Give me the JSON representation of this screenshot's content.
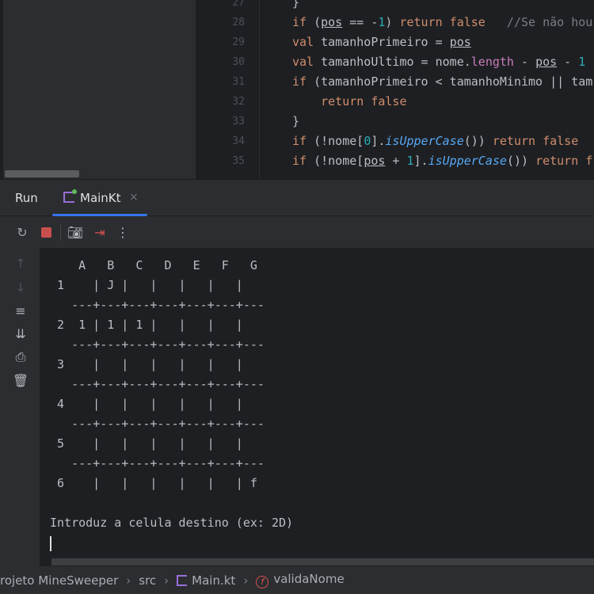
{
  "editor": {
    "lines": [
      {
        "n": "27",
        "tokens": [
          {
            "t": "}",
            "c": ""
          }
        ]
      },
      {
        "n": "28",
        "tokens": [
          {
            "t": "if",
            "c": "kw"
          },
          {
            "t": " (",
            "c": ""
          },
          {
            "t": "pos",
            "c": "u"
          },
          {
            "t": " == -",
            "c": ""
          },
          {
            "t": "1",
            "c": "num"
          },
          {
            "t": ") ",
            "c": ""
          },
          {
            "t": "return false",
            "c": "kw"
          },
          {
            "t": "   //Se não hou",
            "c": "cm"
          }
        ]
      },
      {
        "n": "29",
        "tokens": [
          {
            "t": "val",
            "c": "kw"
          },
          {
            "t": " tamanhoPrimeiro = ",
            "c": ""
          },
          {
            "t": "pos",
            "c": "u"
          }
        ]
      },
      {
        "n": "30",
        "tokens": [
          {
            "t": "val",
            "c": "kw"
          },
          {
            "t": " tamanhoUltimo = nome.",
            "c": ""
          },
          {
            "t": "length",
            "c": "prop"
          },
          {
            "t": " - ",
            "c": ""
          },
          {
            "t": "pos",
            "c": "u"
          },
          {
            "t": " - ",
            "c": ""
          },
          {
            "t": "1",
            "c": "num"
          }
        ]
      },
      {
        "n": "31",
        "tokens": [
          {
            "t": "if",
            "c": "kw"
          },
          {
            "t": " (tamanhoPrimeiro < tamanhoMinimo || tam",
            "c": ""
          }
        ]
      },
      {
        "n": "32",
        "tokens": [
          {
            "t": "    return false",
            "c": "kw"
          }
        ]
      },
      {
        "n": "33",
        "tokens": [
          {
            "t": "}",
            "c": ""
          }
        ]
      },
      {
        "n": "34",
        "tokens": [
          {
            "t": "if",
            "c": "kw"
          },
          {
            "t": " (!nome[",
            "c": ""
          },
          {
            "t": "0",
            "c": "num"
          },
          {
            "t": "].",
            "c": ""
          },
          {
            "t": "isUpperCase",
            "c": "fn"
          },
          {
            "t": "()) ",
            "c": ""
          },
          {
            "t": "return false",
            "c": "kw"
          }
        ]
      },
      {
        "n": "35",
        "tokens": [
          {
            "t": "if",
            "c": "kw"
          },
          {
            "t": " (!nome[",
            "c": ""
          },
          {
            "t": "pos",
            "c": "u"
          },
          {
            "t": " + ",
            "c": ""
          },
          {
            "t": "1",
            "c": "num"
          },
          {
            "t": "].",
            "c": ""
          },
          {
            "t": "isUpperCase",
            "c": "fn"
          },
          {
            "t": "()) ",
            "c": ""
          },
          {
            "t": "return f",
            "c": "kw"
          }
        ]
      }
    ]
  },
  "run_panel": {
    "title": "Run",
    "tab_label": "MainKt",
    "tab_close": "×"
  },
  "console": {
    "lines": [
      "    A   B   C   D   E   F   G",
      " 1    | J |   |   |   |   |",
      "   ---+---+---+---+---+---+---",
      " 2  1 | 1 | 1 |   |   |   |",
      "   ---+---+---+---+---+---+---",
      " 3    |   |   |   |   |   |",
      "   ---+---+---+---+---+---+---",
      " 4    |   |   |   |   |   |",
      "   ---+---+---+---+---+---+---",
      " 5    |   |   |   |   |   |",
      "   ---+---+---+---+---+---+---",
      " 6    |   |   |   |   |   | f",
      "",
      "Introduz a celula destino (ex: 2D)"
    ]
  },
  "breadcrumb": {
    "project": "rojeto MineSweeper",
    "folder": "src",
    "file": "Main.kt",
    "function": "validaNome"
  }
}
